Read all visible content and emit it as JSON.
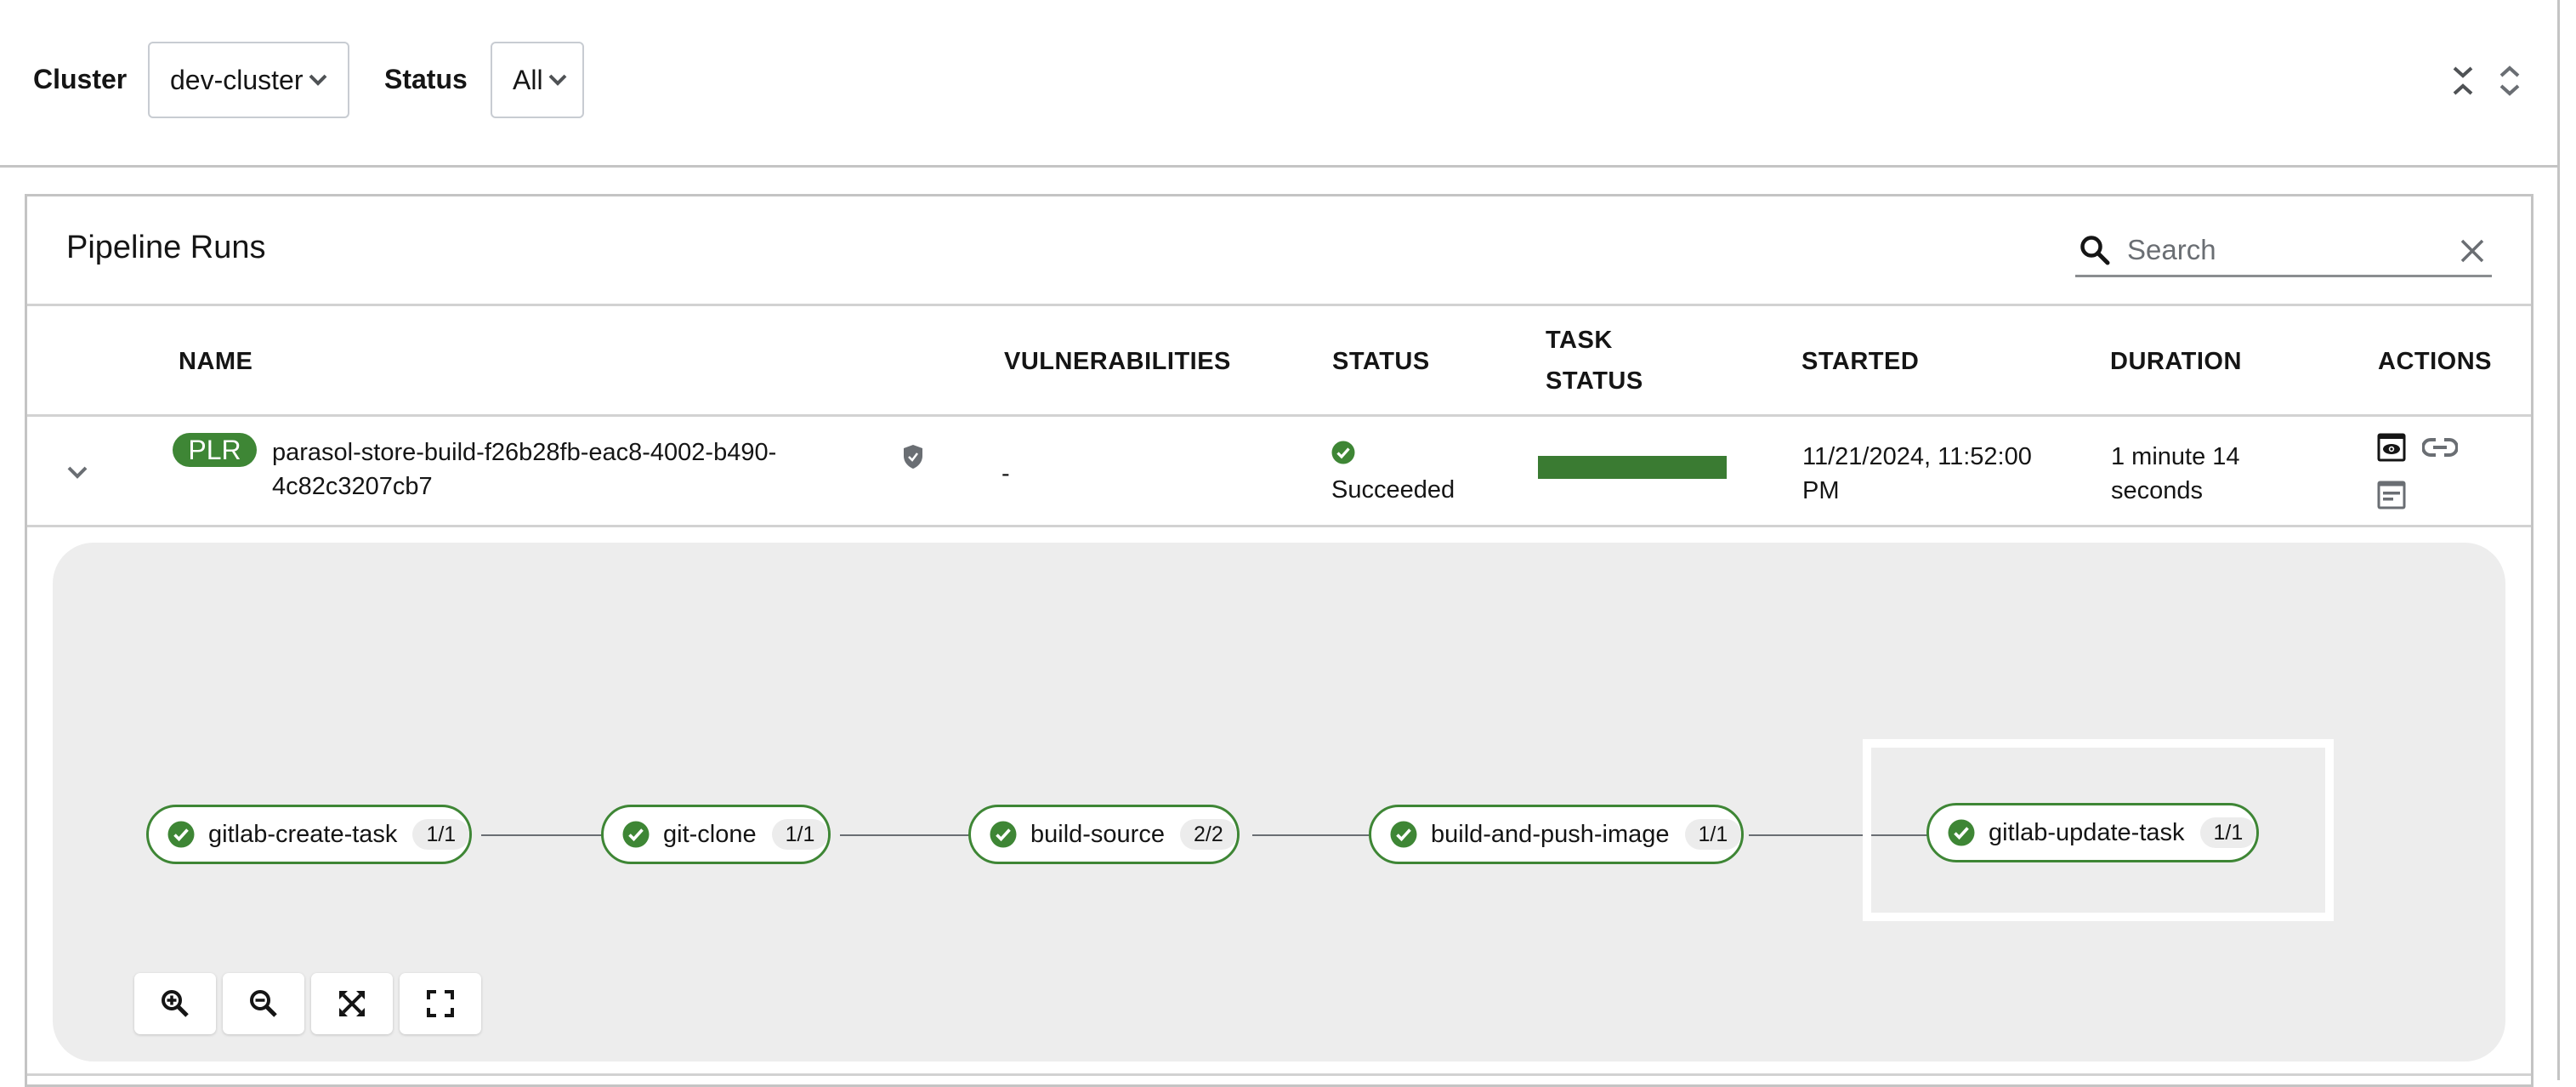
{
  "filters": {
    "cluster_label": "Cluster",
    "cluster_value": "dev-cluster",
    "status_label": "Status",
    "status_value": "All"
  },
  "toolbar": {
    "collapse_all_icon": "collapse-vertical-icon",
    "expand_all_icon": "expand-vertical-icon"
  },
  "card": {
    "title": "Pipeline Runs",
    "search": {
      "placeholder": "Search",
      "value": ""
    }
  },
  "table": {
    "columns": {
      "name": "NAME",
      "vulnerabilities": "VULNERABILITIES",
      "status": "STATUS",
      "task_status_line1": "TASK",
      "task_status_line2": "STATUS",
      "started": "STARTED",
      "duration": "DURATION",
      "actions": "ACTIONS"
    },
    "rows": [
      {
        "expanded": true,
        "kind_badge": "PLR",
        "name_line1": "parasol-store-build-f26b28fb-eac8-4002-b490-",
        "name_line2": "4c82c3207cb7",
        "signed_icon": "shield-check-icon",
        "vulnerabilities": "-",
        "status": "Succeeded",
        "task_status_succeeded_fraction": 1.0,
        "started_line1": "11/21/2024, 11:52:00",
        "started_line2": "PM",
        "duration_line1": "1 minute 14",
        "duration_line2": "seconds",
        "actions": [
          "view-output-icon",
          "link-icon",
          "view-logs-icon"
        ]
      }
    ]
  },
  "pipeline_graph": {
    "tasks": [
      {
        "name": "gitlab-create-task",
        "count": "1/1",
        "status": "succeeded"
      },
      {
        "name": "git-clone",
        "count": "1/1",
        "status": "succeeded"
      },
      {
        "name": "build-source",
        "count": "2/2",
        "status": "succeeded"
      },
      {
        "name": "build-and-push-image",
        "count": "1/1",
        "status": "succeeded"
      },
      {
        "name": "gitlab-update-task",
        "count": "1/1",
        "status": "succeeded"
      }
    ],
    "controls": [
      "zoom-in",
      "zoom-out",
      "fit-to-screen",
      "reset-view"
    ]
  },
  "colors": {
    "success": "#3e8635",
    "panel_bg": "#ededed",
    "border": "#c4c4c4"
  }
}
